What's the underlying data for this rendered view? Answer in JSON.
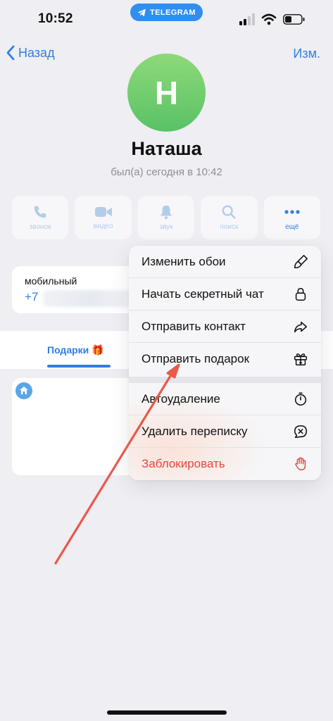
{
  "status_bar": {
    "time": "10:52",
    "app_pill": "TELEGRAM"
  },
  "nav": {
    "back_label": "Назад",
    "edit_label": "Изм."
  },
  "profile": {
    "initial": "Н",
    "name": "Наташа",
    "last_seen": "был(а) сегодня в 10:42",
    "avatar_color": "#6ecb6e"
  },
  "actions": [
    {
      "label": "звонок",
      "icon": "phone-icon"
    },
    {
      "label": "видео",
      "icon": "video-camera-icon"
    },
    {
      "label": "звук",
      "icon": "bell-icon"
    },
    {
      "label": "поиск",
      "icon": "search-icon"
    },
    {
      "label": "ещё",
      "icon": "more-dots-icon"
    }
  ],
  "info": {
    "label": "мобильный",
    "value": "+7"
  },
  "tabs": {
    "gifts_label": "Подарки 🎁"
  },
  "menu": {
    "items": [
      {
        "label": "Изменить обои",
        "icon": "paintbrush-icon"
      },
      {
        "label": "Начать секретный чат",
        "icon": "lock-icon"
      },
      {
        "label": "Отправить контакт",
        "icon": "share-arrow-icon"
      },
      {
        "label": "Отправить подарок",
        "icon": "gift-icon"
      },
      {
        "label": "Автоудаление",
        "icon": "timer-icon"
      },
      {
        "label": "Удалить переписку",
        "icon": "delete-chat-icon"
      },
      {
        "label": "Заблокировать",
        "icon": "hand-stop-icon"
      }
    ]
  },
  "colors": {
    "accent": "#2f7fe0",
    "danger": "#e5483f",
    "annotation_arrow": "#e8594a"
  }
}
